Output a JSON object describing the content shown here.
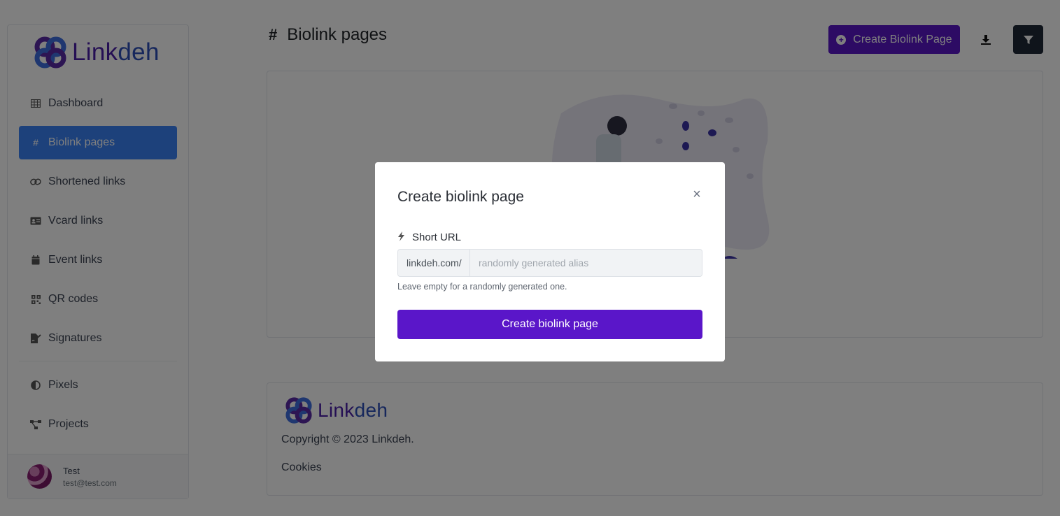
{
  "brand": {
    "name_part1": "Link",
    "name_part2": "deh"
  },
  "sidebar": {
    "items": [
      {
        "label": "Dashboard",
        "icon": "table-icon",
        "active": false
      },
      {
        "label": "Biolink pages",
        "icon": "hashtag-icon",
        "active": true
      },
      {
        "label": "Shortened links",
        "icon": "link-icon",
        "active": false
      },
      {
        "label": "Vcard links",
        "icon": "id-card-icon",
        "active": false
      },
      {
        "label": "Event links",
        "icon": "calendar-icon",
        "active": false
      },
      {
        "label": "QR codes",
        "icon": "qrcode-icon",
        "active": false
      },
      {
        "label": "Signatures",
        "icon": "file-signature-icon",
        "active": false
      },
      {
        "label": "Pixels",
        "icon": "adjust-icon",
        "active": false
      },
      {
        "label": "Projects",
        "icon": "project-diagram-icon",
        "active": false
      }
    ]
  },
  "user": {
    "name": "Test",
    "email": "test@test.com"
  },
  "header": {
    "title": "Biolink pages",
    "create_button": "Create Biolink Page"
  },
  "footer": {
    "copyright": "Copyright © 2023 Linkdeh.",
    "cookies": "Cookies"
  },
  "modal": {
    "title": "Create biolink page",
    "close": "×",
    "short_url_label": "Short URL",
    "prefix": "linkdeh.com/",
    "placeholder": "randomly generated alias",
    "value": "",
    "help": "Leave empty for a randomly generated one.",
    "submit": "Create biolink page"
  },
  "colors": {
    "primary": "#5a16c9",
    "active_nav": "#3b82f6",
    "dark": "#1f2937"
  }
}
